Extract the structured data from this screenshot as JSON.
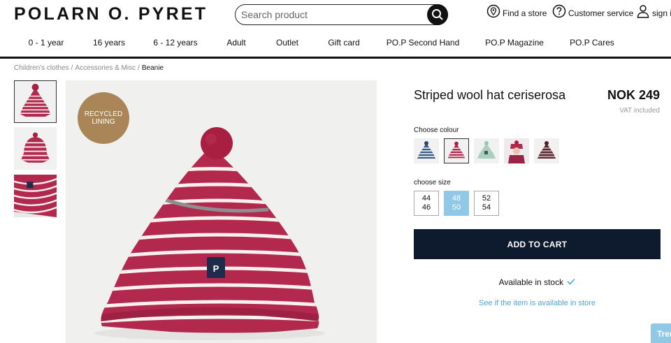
{
  "header": {
    "logo": "POLARN O. PYRET",
    "search_placeholder": "Search product",
    "find_store": "Find a store",
    "customer_service": "Customer service",
    "sign_in": "sign in"
  },
  "nav": [
    "0 - 1 year",
    "16 years",
    "6 - 12 years",
    "Adult",
    "Outlet",
    "Gift card",
    "PO.P Second Hand",
    "PO.P Magazine",
    "PO.P Cares"
  ],
  "breadcrumb": {
    "items": [
      "Children's clothes",
      "Accessories & Misc"
    ],
    "separator": "/",
    "current": "Beanie"
  },
  "badge": "RECYCLED LINING",
  "product": {
    "title": "Striped wool hat ceriserosa",
    "price": "NOK 249",
    "vat_note": "VAT included",
    "colour_label": "Choose colour",
    "size_label": "choose size",
    "sizes": [
      {
        "line1": "44",
        "line2": "46",
        "selected": false
      },
      {
        "line1": "48",
        "line2": "50",
        "selected": true
      },
      {
        "line1": "52",
        "line2": "54",
        "selected": false
      }
    ],
    "add_to_cart": "ADD TO CART",
    "stock_text": "Available in stock",
    "store_link": "See if the item is available in store"
  },
  "swatches": [
    {
      "name": "navy striped",
      "base": "#3d5a86",
      "stripe": "#ffffff"
    },
    {
      "name": "ceriserosa striped",
      "base": "#b3294d",
      "stripe": "#ffffff"
    },
    {
      "name": "mint",
      "base": "#a9cfbf",
      "stripe": "#a9cfbf"
    },
    {
      "name": "pink model",
      "base": "#9a2445",
      "stripe": "#9a2445"
    },
    {
      "name": "dark red striped",
      "base": "#5a2a33",
      "stripe": "#e8d7da"
    }
  ],
  "chat_tab": "Trer",
  "colors": {
    "hat": "#b3294d",
    "stripe": "#f7f2ee",
    "pompom": "#a81f42",
    "badge": "#a98558",
    "cart": "#0e1a2e",
    "accent": "#8fc9e6",
    "link": "#4aa6d6"
  }
}
